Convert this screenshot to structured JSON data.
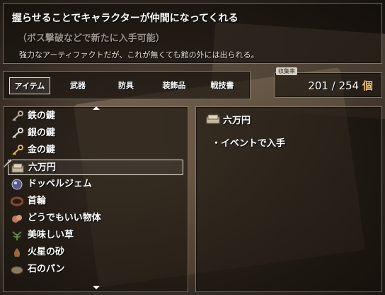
{
  "help": {
    "line1": "握らせることでキャラクターが仲間になってくれる",
    "line2": "（ボス撃破などで新たに入手可能）",
    "line3": "強力なアーティファクトだが、これが無くても館の外には出られる。"
  },
  "categories": [
    {
      "label": "アイテム",
      "selected": true
    },
    {
      "label": "武器",
      "selected": false
    },
    {
      "label": "防具",
      "selected": false
    },
    {
      "label": "装飾品",
      "selected": false
    },
    {
      "label": "戦技書",
      "selected": false
    }
  ],
  "collection": {
    "label": "収集率",
    "value": "201 / 254",
    "unit": "個"
  },
  "items": [
    {
      "label": "鉄の鍵",
      "icon": "iron-key-icon",
      "color": "#b8b0a4"
    },
    {
      "label": "銀の鍵",
      "icon": "silver-key-icon",
      "color": "#e0dcd6"
    },
    {
      "label": "金の鍵",
      "icon": "gold-key-icon",
      "color": "#d8b66a"
    },
    {
      "label": "六万円",
      "icon": "money-bundle-icon",
      "color": "#c8bba0",
      "selected": true
    },
    {
      "label": "ドッペルジェム",
      "icon": "gem-icon",
      "color": "#8a8ab8"
    },
    {
      "label": "首輪",
      "icon": "collar-icon",
      "color": "#8a4a32"
    },
    {
      "label": "どうでもいい物体",
      "icon": "object-icon",
      "color": "#c07860"
    },
    {
      "label": "美味しい草",
      "icon": "herb-icon",
      "color": "#5a8a48"
    },
    {
      "label": "火星の砂",
      "icon": "sand-icon",
      "color": "#9a6a3a"
    },
    {
      "label": "石のパン",
      "icon": "stone-bread-icon",
      "color": "#8a7a62"
    }
  ],
  "detail": {
    "name": "六万円",
    "icon": "money-bundle-icon",
    "info": "・イベントで入手"
  }
}
